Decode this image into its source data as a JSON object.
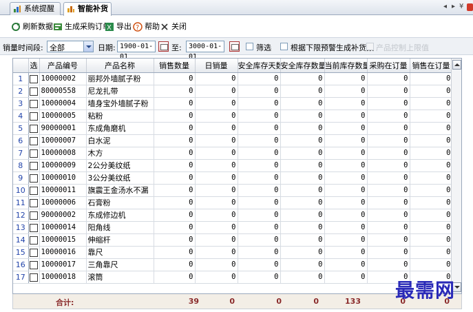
{
  "tabs": [
    {
      "label": "系统提醒",
      "active": false
    },
    {
      "label": "智能补货",
      "active": true
    }
  ],
  "tab_controls": {
    "prev": "◂",
    "next": "▸",
    "menu": "¥"
  },
  "toolbar": {
    "refresh": "刷新数据",
    "generate_order": "生成采购订单",
    "export": "导出",
    "help": "帮助",
    "close": "关闭"
  },
  "filter": {
    "period_label": "销量时间段:",
    "period_value": "全部",
    "date_label": "日期:",
    "date_from": "1900-01-01",
    "to_label": "至:",
    "date_to": "3000-01-01",
    "screen_label": "筛选",
    "lower_limit_label": "根据下限预警生成补货数",
    "disabled_label": "产品控制上限值"
  },
  "grid": {
    "headers": [
      "选",
      "产品编号",
      "产品名称",
      "销售数量",
      "日销量",
      "安全库存天数",
      "安全库存数量",
      "当前库存数量",
      "采购在订量",
      "销售在订量"
    ],
    "rows": [
      {
        "n": "1",
        "code": "10000002",
        "name": "丽邦外墙腻子粉",
        "v": [
          "0",
          "0",
          "0",
          "0",
          "0",
          "0",
          "0"
        ]
      },
      {
        "n": "2",
        "code": "80000558",
        "name": "尼龙扎带",
        "v": [
          "0",
          "0",
          "0",
          "0",
          "0",
          "0",
          "0"
        ]
      },
      {
        "n": "3",
        "code": "10000004",
        "name": "墙身宝外墙腻子粉",
        "v": [
          "0",
          "0",
          "0",
          "0",
          "0",
          "0",
          "0"
        ]
      },
      {
        "n": "4",
        "code": "10000005",
        "name": "粘粉",
        "v": [
          "0",
          "0",
          "0",
          "0",
          "0",
          "0",
          "0"
        ]
      },
      {
        "n": "5",
        "code": "90000001",
        "name": "东成角磨机",
        "v": [
          "0",
          "0",
          "0",
          "0",
          "0",
          "0",
          "0"
        ]
      },
      {
        "n": "6",
        "code": "10000007",
        "name": "白水泥",
        "v": [
          "0",
          "0",
          "0",
          "0",
          "0",
          "0",
          "0"
        ]
      },
      {
        "n": "7",
        "code": "10000008",
        "name": "木方",
        "v": [
          "0",
          "0",
          "0",
          "0",
          "0",
          "0",
          "0"
        ]
      },
      {
        "n": "8",
        "code": "10000009",
        "name": "2公分美纹纸",
        "v": [
          "0",
          "0",
          "0",
          "0",
          "0",
          "0",
          "0"
        ]
      },
      {
        "n": "9",
        "code": "10000010",
        "name": "3公分美纹纸",
        "v": [
          "0",
          "0",
          "0",
          "0",
          "0",
          "0",
          "0"
        ]
      },
      {
        "n": "10",
        "code": "10000011",
        "name": "旗震王金汤水不漏",
        "v": [
          "0",
          "0",
          "0",
          "0",
          "0",
          "0",
          "0"
        ]
      },
      {
        "n": "11",
        "code": "10000006",
        "name": "石膏粉",
        "v": [
          "0",
          "0",
          "0",
          "0",
          "0",
          "0",
          "0"
        ]
      },
      {
        "n": "12",
        "code": "90000002",
        "name": "东成修边机",
        "v": [
          "0",
          "0",
          "0",
          "0",
          "0",
          "0",
          "0"
        ]
      },
      {
        "n": "13",
        "code": "10000014",
        "name": "阳角线",
        "v": [
          "0",
          "0",
          "0",
          "0",
          "0",
          "0",
          "0"
        ]
      },
      {
        "n": "14",
        "code": "10000015",
        "name": "伸缩杆",
        "v": [
          "0",
          "0",
          "0",
          "0",
          "0",
          "0",
          "0"
        ]
      },
      {
        "n": "15",
        "code": "10000016",
        "name": "靠尺",
        "v": [
          "0",
          "0",
          "0",
          "0",
          "0",
          "0",
          "0"
        ]
      },
      {
        "n": "16",
        "code": "10000017",
        "name": "三角靠尺",
        "v": [
          "0",
          "0",
          "0",
          "0",
          "0",
          "0",
          "0"
        ]
      },
      {
        "n": "17",
        "code": "10000018",
        "name": "滚筒",
        "v": [
          "0",
          "0",
          "0",
          "0",
          "0",
          "0",
          "0"
        ]
      }
    ]
  },
  "totals": {
    "label": "合计:",
    "sales_qty": "39",
    "daily_sales": "0",
    "safety_days": "0",
    "safety_qty": "0",
    "current_stock": "133",
    "purchase_on_order": "0",
    "sales_on_order": "0"
  },
  "watermark": "最需网",
  "colors": {
    "row_number": "#2244aa",
    "totals_text": "#8a2a2a",
    "watermark": "#2a2ab8"
  }
}
